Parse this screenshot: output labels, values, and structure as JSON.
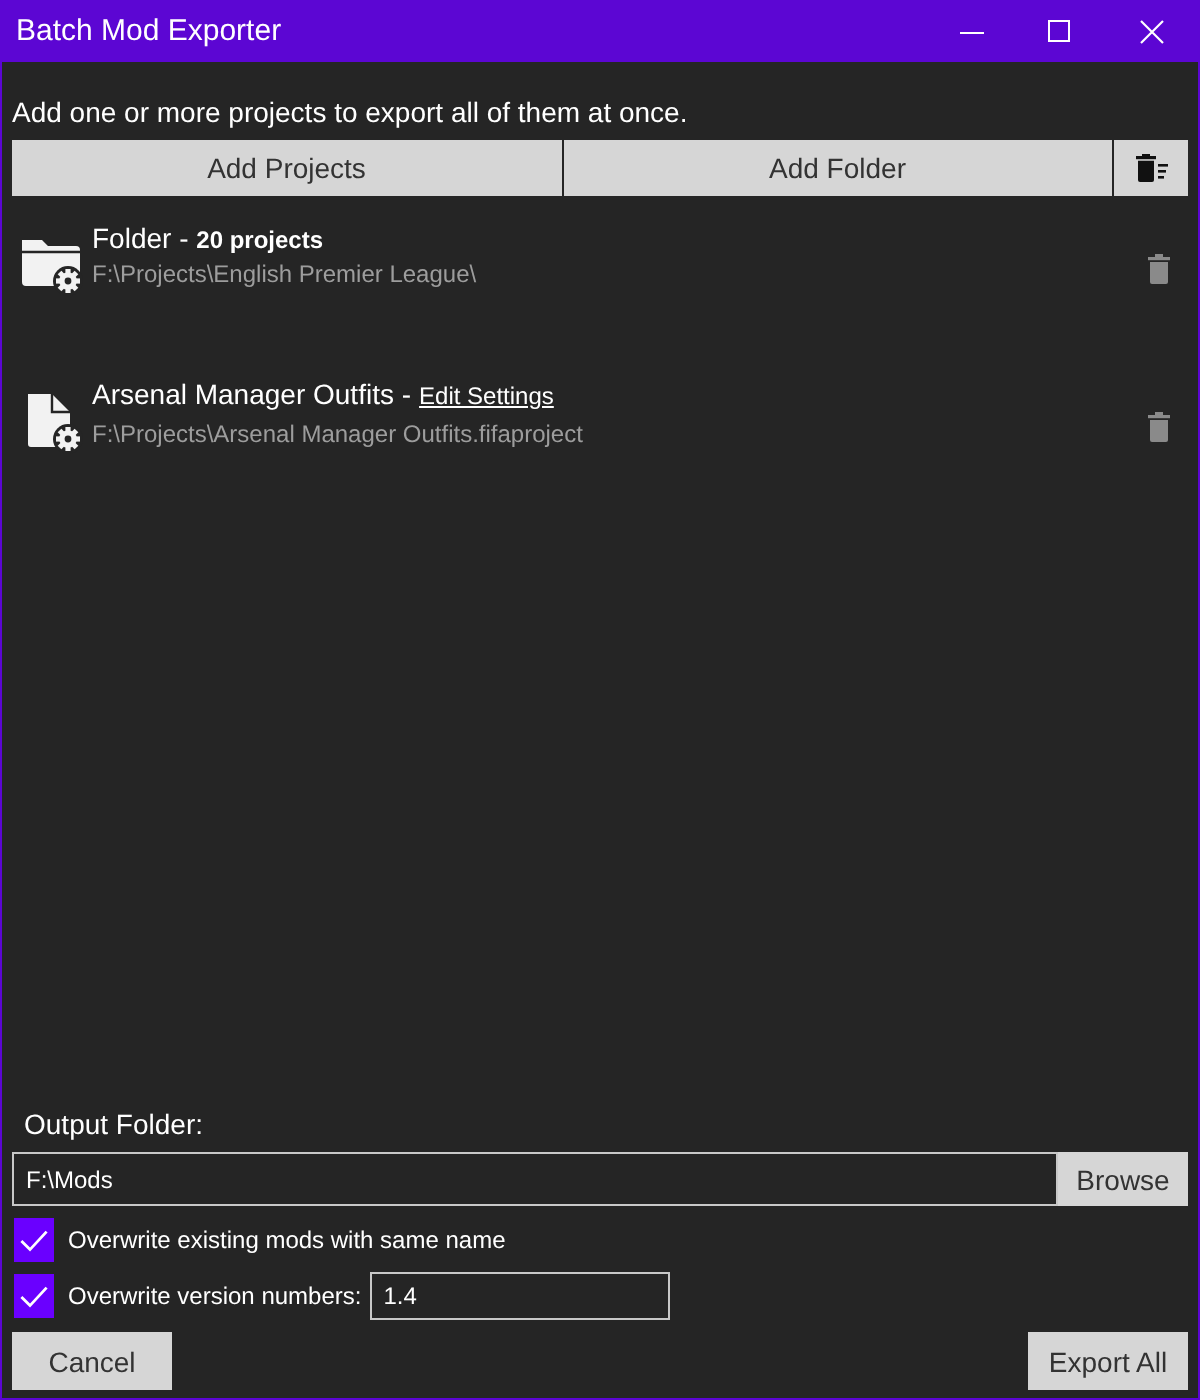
{
  "window": {
    "title": "Batch Mod Exporter"
  },
  "instructions": "Add one or more projects to export all of them at once.",
  "toolbar": {
    "buttons": [
      "Add Projects",
      "Add Folder"
    ]
  },
  "projects": [
    {
      "kind": "folder",
      "name": "Folder",
      "separator": "-",
      "detail": "20 projects",
      "path": "F:\\Projects\\English Premier League\\"
    },
    {
      "kind": "project",
      "name": "Arsenal Manager Outfits",
      "separator": "-",
      "link": "Edit Settings",
      "path": "F:\\Projects\\Arsenal Manager Outfits.fifaproject"
    }
  ],
  "output": {
    "label": "Output Folder:",
    "value": "F:\\Mods",
    "browse": "Browse"
  },
  "options": [
    {
      "kind": "checkbox",
      "label": "Overwrite existing mods with same name",
      "checked": true
    },
    {
      "kind": "checkbox-field",
      "label": "Overwrite version numbers:",
      "checked": true,
      "value": "1.4"
    }
  ],
  "footer": {
    "buttons": [
      "Cancel",
      "Export All"
    ]
  }
}
